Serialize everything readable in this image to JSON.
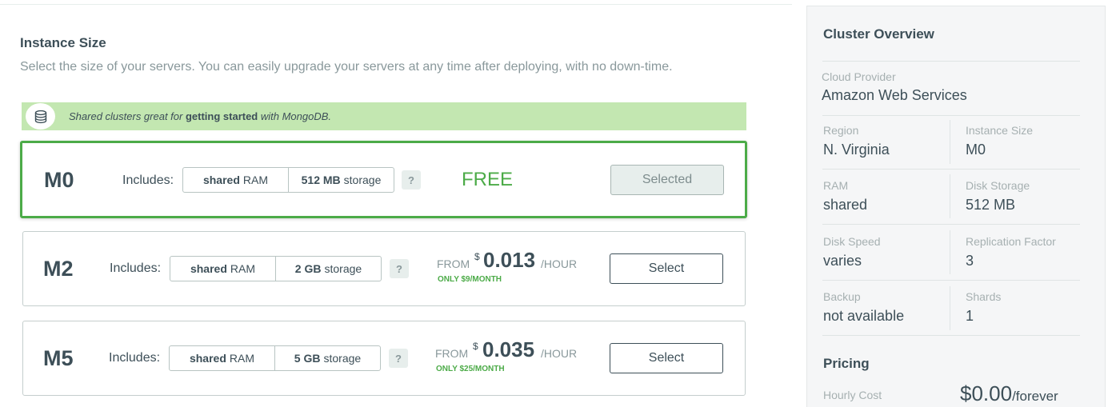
{
  "instance_size": {
    "title": "Instance Size",
    "subtitle": "Select the size of your servers. You can easily upgrade your servers at any time after deploying, with no down-time.",
    "banner": {
      "prefix": "Shared clusters great for ",
      "emphasis": "getting started",
      "suffix": " with MongoDB.",
      "icon": "database-icon"
    },
    "includes_label": "Includes:",
    "help_label": "?",
    "tiers": [
      {
        "name": "M0",
        "ram_value": "shared",
        "ram_unit": "RAM",
        "storage_value": "512 MB",
        "storage_unit": "storage",
        "price_text": "FREE",
        "button": "Selected",
        "selected": true
      },
      {
        "name": "M2",
        "ram_value": "shared",
        "ram_unit": "RAM",
        "storage_value": "2 GB",
        "storage_unit": "storage",
        "from": "FROM",
        "currency": "$",
        "price": "0.013",
        "per": "/HOUR",
        "monthly": "ONLY $9/MONTH",
        "button": "Select",
        "selected": false
      },
      {
        "name": "M5",
        "ram_value": "shared",
        "ram_unit": "RAM",
        "storage_value": "5 GB",
        "storage_unit": "storage",
        "from": "FROM",
        "currency": "$",
        "price": "0.035",
        "per": "/HOUR",
        "monthly": "ONLY $25/MONTH",
        "button": "Select",
        "selected": false
      }
    ]
  },
  "overview": {
    "title": "Cluster Overview",
    "cloud_provider": {
      "label": "Cloud Provider",
      "value": "Amazon Web Services"
    },
    "region": {
      "label": "Region",
      "value": "N. Virginia"
    },
    "instance_size": {
      "label": "Instance Size",
      "value": "M0"
    },
    "ram": {
      "label": "RAM",
      "value": "shared"
    },
    "disk_storage": {
      "label": "Disk Storage",
      "value": "512 MB"
    },
    "disk_speed": {
      "label": "Disk Speed",
      "value": "varies"
    },
    "replication_factor": {
      "label": "Replication Factor",
      "value": "3"
    },
    "backup": {
      "label": "Backup",
      "value": "not available"
    },
    "shards": {
      "label": "Shards",
      "value": "1"
    },
    "pricing": {
      "title": "Pricing",
      "hourly_label": "Hourly Cost",
      "hourly_value": "$0.00",
      "hourly_suffix": "/forever"
    }
  },
  "colors": {
    "accent_green": "#4cab48",
    "banner_green": "#c3e7b1",
    "text_dark": "#3d4f58",
    "text_muted": "#89989b"
  }
}
